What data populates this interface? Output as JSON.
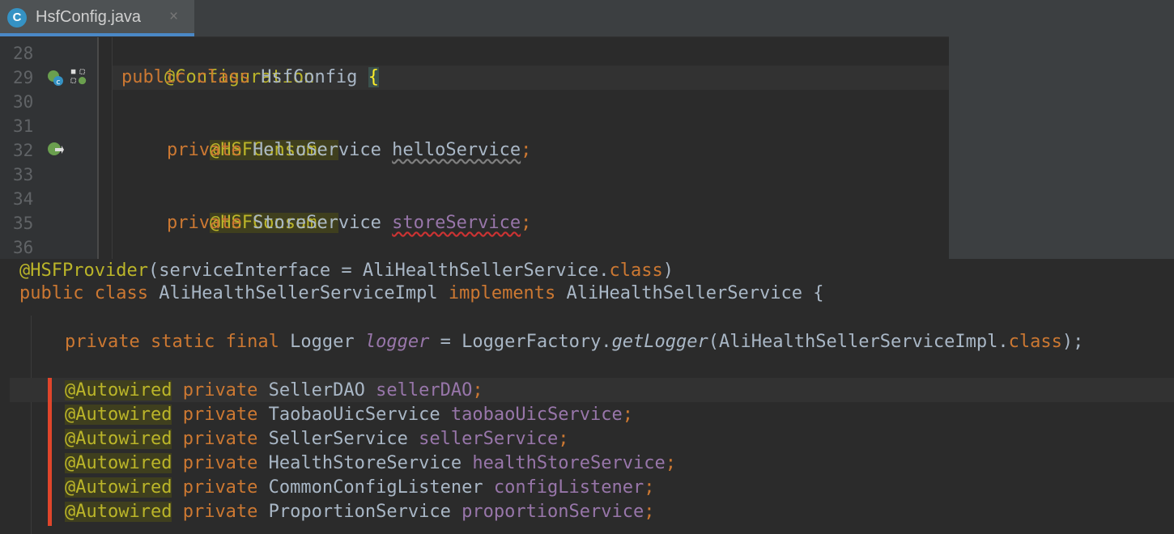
{
  "editor_top": {
    "tab": {
      "icon_letter": "C",
      "file_name": "HsfConfig.java",
      "close_glyph": "×"
    },
    "line_numbers": [
      "28",
      "29",
      "30",
      "31",
      "32",
      "33",
      "34",
      "35",
      "36"
    ],
    "lines": {
      "l28_annotation": "@Configuration",
      "l29_public": "public",
      "l29_class": "class",
      "l29_name": "HsfConfig",
      "l29_brace": "{",
      "l31_annotation": "@HSFConsumer",
      "l32_private": "private",
      "l32_type": "HelloService",
      "l32_field": "helloService",
      "l32_semicolon": ";",
      "l34_annotation": "@HSFConsumer",
      "l35_private": "private",
      "l35_type": "StoreService",
      "l35_field": "storeService",
      "l35_semicolon": ";"
    },
    "gutter_icons": [
      "spring-bean-icon",
      "structure-icon",
      "spring-autowire-icon"
    ]
  },
  "editor_bottom": {
    "line1": {
      "annotation": "@HSFProvider",
      "open": "(",
      "param": "serviceInterface",
      "eq": " = ",
      "value": "AliHealthSellerService.",
      "class_kw": "class",
      "close": ")"
    },
    "line2": {
      "public": "public",
      "class": "class",
      "name": "AliHealthSellerServiceImpl",
      "implements": "implements",
      "iface": "AliHealthSellerService",
      "brace": "{"
    },
    "line3": {
      "mods": "private static final",
      "type": "Logger",
      "field": "logger",
      "eq": " = ",
      "factory": "LoggerFactory.",
      "method": "getLogger",
      "arg": "(AliHealthSellerServiceImpl.",
      "class_kw": "class",
      "end": ");"
    },
    "autowired_fields": [
      {
        "annotation": "@Autowired",
        "modifier": "private",
        "type": "SellerDAO",
        "name": "sellerDAO",
        "end": ";"
      },
      {
        "annotation": "@Autowired",
        "modifier": "private",
        "type": "TaobaoUicService",
        "name": "taobaoUicService",
        "end": ";"
      },
      {
        "annotation": "@Autowired",
        "modifier": "private",
        "type": "SellerService",
        "name": "sellerService",
        "end": ";"
      },
      {
        "annotation": "@Autowired",
        "modifier": "private",
        "type": "HealthStoreService",
        "name": "healthStoreService",
        "end": ";"
      },
      {
        "annotation": "@Autowired",
        "modifier": "private",
        "type": "CommonConfigListener",
        "name": "configListener",
        "end": ";"
      },
      {
        "annotation": "@Autowired",
        "modifier": "private",
        "type": "ProportionService",
        "name": "proportionService",
        "end": ";"
      }
    ]
  },
  "colors": {
    "background": "#2b2b2b",
    "keyword": "#cc7832",
    "annotation": "#bbb529",
    "field": "#9876aa",
    "text": "#a9b7c6",
    "marker": "#e0452b",
    "tab_underline": "#4a88c7"
  }
}
